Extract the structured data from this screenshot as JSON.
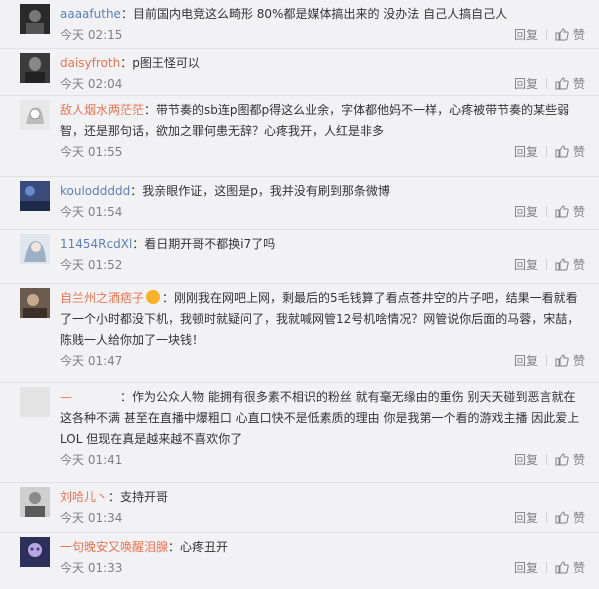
{
  "comments": [
    {
      "user": "aaaafuthe",
      "text": "目前国内电竞这么畸形 80%都是媒体搞出来的 没办法 自己人搞自己人",
      "time": "今天 02:15",
      "reply": "回复",
      "like": "赞"
    },
    {
      "user": "daisyfroth",
      "text": "p图王怪可以",
      "time": "今天 02:04",
      "reply": "回复",
      "like": "赞"
    },
    {
      "user": "敌人烟水两茫茫",
      "text": "带节奏的sb连p图都p得这么业余，字体都他妈不一样，心疼被带节奏的某些弱智，还是那句话，欲加之罪何患无辞？心疼我开，人红是非多",
      "time": "今天 01:55",
      "reply": "回复",
      "like": "赞"
    },
    {
      "user": "kouloddddd",
      "text": "我亲眼作证，这图是p，我并没有刷到那条微博",
      "time": "今天 01:54",
      "reply": "回复",
      "like": "赞"
    },
    {
      "user": "11454RcdXl",
      "text": "看日期开哥不都换i7了吗",
      "time": "今天 01:52",
      "reply": "回复",
      "like": "赞"
    },
    {
      "user": "自兰州之酒痞子",
      "text": "刚刚我在网吧上网，剩最后的5毛钱算了看点苍井空的片子吧，结果一看就看了一个小时都没下机，我顿时就疑问了，我就喊网管12号机啥情况？网管说你后面的马蓉，宋喆，陈贱一人给你加了一块钱！",
      "time": "今天 01:47",
      "reply": "回复",
      "like": "赞"
    },
    {
      "user": "—",
      "text": "作为公众人物  能拥有很多素不相识的粉丝 就有毫无缘由的重伤 别天天碰到恶言就在这各种不满 甚至在直播中爆粗口 心直口快不是低素质的理由 你是我第一个看的游戏主播 因此爱上LOL 但现在真是越来越不喜欢你了",
      "time": "今天 01:41",
      "reply": "回复",
      "like": "赞"
    },
    {
      "user": "刘哈儿丶",
      "text": "支持开哥",
      "time": "今天 01:34",
      "reply": "回复",
      "like": "赞"
    },
    {
      "user": "一句晚安又唤醒泪腺",
      "text": "心疼丑开",
      "time": "今天 01:33",
      "reply": "回复",
      "like": "赞"
    }
  ]
}
